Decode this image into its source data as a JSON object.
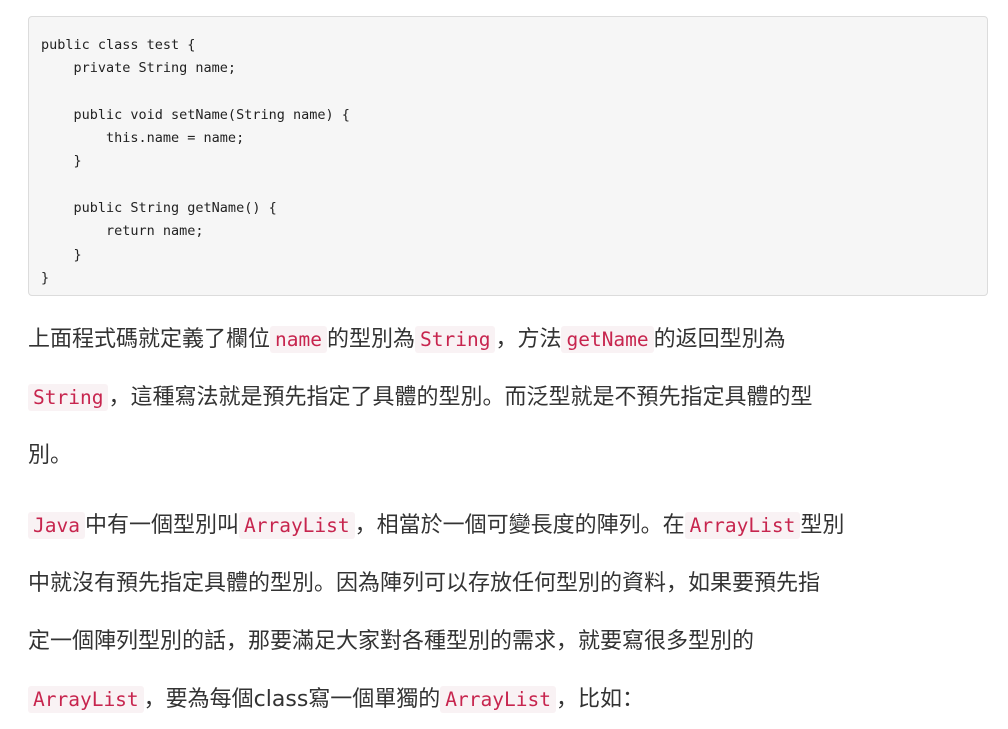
{
  "code_block": {
    "lines": [
      "public class test {",
      "    private String name;",
      "",
      "    public void setName(String name) {",
      "        this.name = name;",
      "    }",
      "",
      "    public String getName() {",
      "        return name;",
      "    }",
      "}"
    ]
  },
  "paragraph1": {
    "l1_t1": "上面程式碼就定義了欄位",
    "l1_c1": "name",
    "l1_t2": "的型別為",
    "l1_c2": "String",
    "l1_t3": "，方法",
    "l1_c3": "getName",
    "l1_t4": "的返回型別為",
    "l2_c1": "String",
    "l2_t1": "，這種寫法就是預先指定了具體的型別。而泛型就是不預先指定具體的型",
    "l3_t1": "別。"
  },
  "paragraph2": {
    "l1_c1": "Java",
    "l1_t1": "中有一個型別叫",
    "l1_c2": "ArrayList",
    "l1_t2": "，相當於一個可變長度的陣列。在",
    "l1_c3": "ArrayList",
    "l1_t3": "型別",
    "l2_t1": "中就沒有預先指定具體的型別。因為陣列可以存放任何型別的資料，如果要預先指",
    "l3_t1": "定一個陣列型別的話，那要滿足大家對各種型別的需求，就要寫很多型別的",
    "l4_c1": "ArrayList",
    "l4_t1": "，要為每個class寫一個單獨的",
    "l4_c2": "ArrayList",
    "l4_t2": "，比如："
  }
}
